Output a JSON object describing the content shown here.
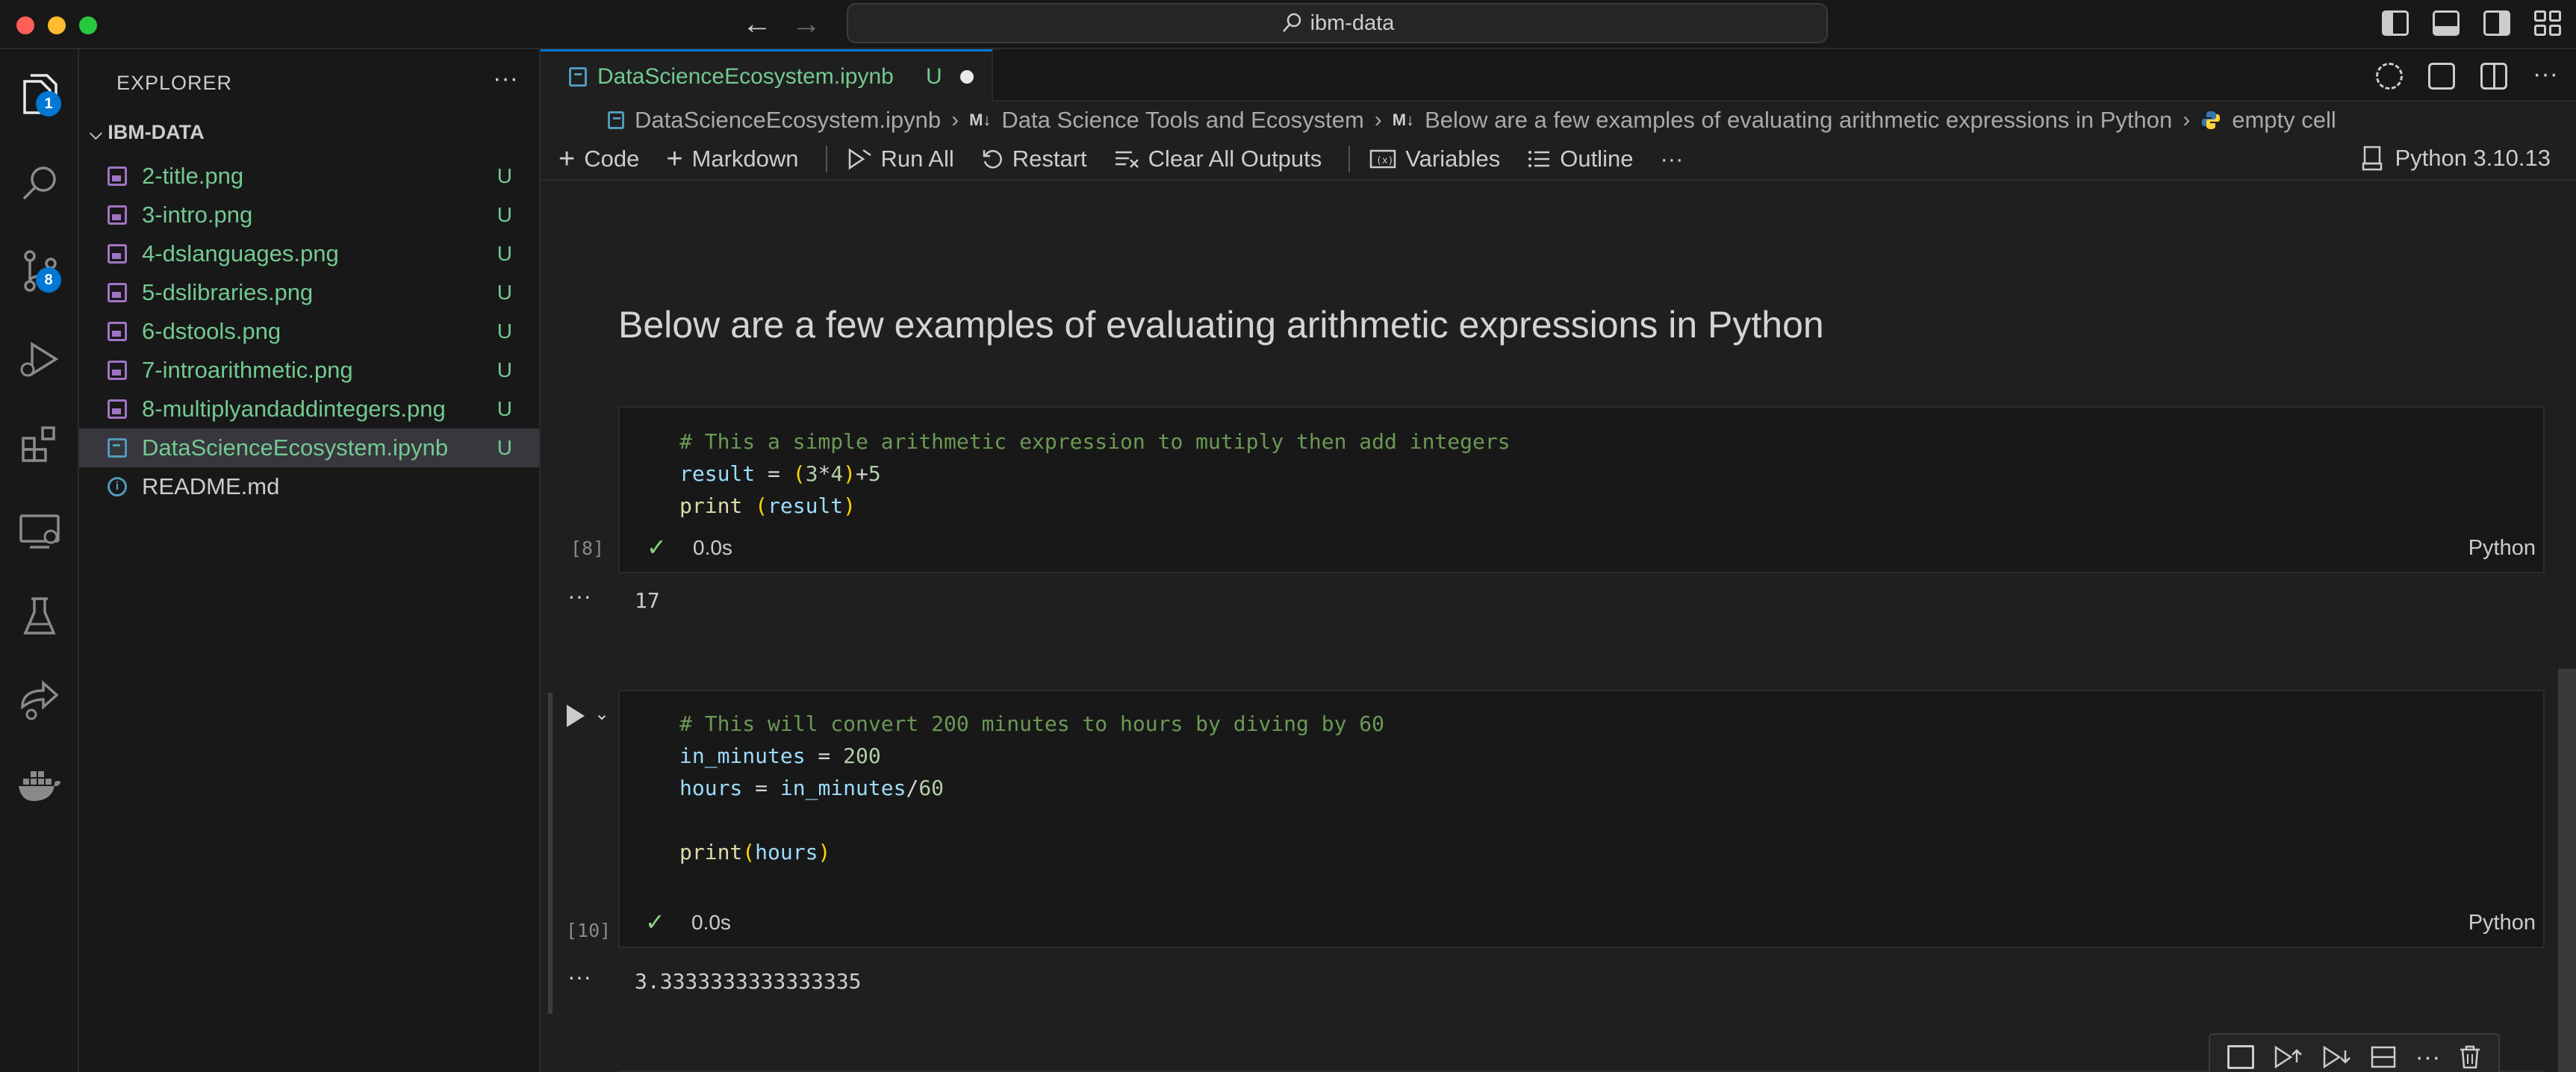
{
  "window": {
    "search_text": "ibm-data"
  },
  "activity_bar": {
    "explorer_badge": "1",
    "scm_badge": "8",
    "items": [
      "files-icon",
      "search-icon",
      "source-control-icon",
      "run-debug-icon",
      "extensions-icon",
      "remote-explorer-icon",
      "testing-icon",
      "live-share-icon",
      "docker-icon"
    ]
  },
  "sidebar": {
    "title": "EXPLORER",
    "folder": "IBM-DATA",
    "files": [
      {
        "name": "2-title.png",
        "status": "U",
        "type": "image"
      },
      {
        "name": "3-intro.png",
        "status": "U",
        "type": "image"
      },
      {
        "name": "4-dslanguages.png",
        "status": "U",
        "type": "image"
      },
      {
        "name": "5-dslibraries.png",
        "status": "U",
        "type": "image"
      },
      {
        "name": "6-dstools.png",
        "status": "U",
        "type": "image"
      },
      {
        "name": "7-introarithmetic.png",
        "status": "U",
        "type": "image"
      },
      {
        "name": "8-multiplyandaddintegers.png",
        "status": "U",
        "type": "image"
      },
      {
        "name": "DataScienceEcosystem.ipynb",
        "status": "U",
        "type": "notebook"
      },
      {
        "name": "README.md",
        "status": "",
        "type": "info"
      }
    ]
  },
  "tab": {
    "name": "DataScienceEcosystem.ipynb",
    "status": "U"
  },
  "breadcrumb": {
    "file": "DataScienceEcosystem.ipynb",
    "md_tag": "M↓",
    "section1": "Data Science Tools and Ecosystem",
    "section2": "Below are a few examples of evaluating arithmetic expressions in Python",
    "cell": "empty cell"
  },
  "toolbar": {
    "code": "Code",
    "markdown": "Markdown",
    "run_all": "Run All",
    "restart": "Restart",
    "clear_outputs": "Clear All Outputs",
    "variables": "Variables",
    "outline": "Outline",
    "more": "···",
    "kernel": "Python 3.10.13"
  },
  "notebook": {
    "heading": "Below are a few examples of evaluating arithmetic expressions in Python",
    "cells": [
      {
        "exec_count": "[8]",
        "duration": "0.0s",
        "language": "Python",
        "lines": {
          "l1_comment": "# This a simple arithmetic expression to mutiply then add integers",
          "l2_var": "result",
          "l2_eq": " = ",
          "l2_open": "(",
          "l2_num1": "3",
          "l2_op": "*",
          "l2_num2": "4",
          "l2_close": ")",
          "l2_plus": "+",
          "l2_num3": "5",
          "l3_fn": "print",
          "l3_sp": " ",
          "l3_open": "(",
          "l3_var": "result",
          "l3_close": ")"
        },
        "output": "17"
      },
      {
        "exec_count": "[10]",
        "duration": "0.0s",
        "language": "Python",
        "lines": {
          "l1_comment": "# This will convert 200 minutes to hours by diving by 60",
          "l2_var": "in_minutes",
          "l2_eq": " = ",
          "l2_num": "200",
          "l3_var": "hours",
          "l3_eq": " = ",
          "l3_var2": "in_minutes",
          "l3_op": "/",
          "l3_num": "60",
          "l5_fn": "print",
          "l5_open": "(",
          "l5_var": "hours",
          "l5_close": ")"
        },
        "output": "3.3333333333333335"
      }
    ]
  },
  "colors": {
    "accent": "#0078d4",
    "untracked": "#73c991",
    "comment": "#6a9955"
  }
}
